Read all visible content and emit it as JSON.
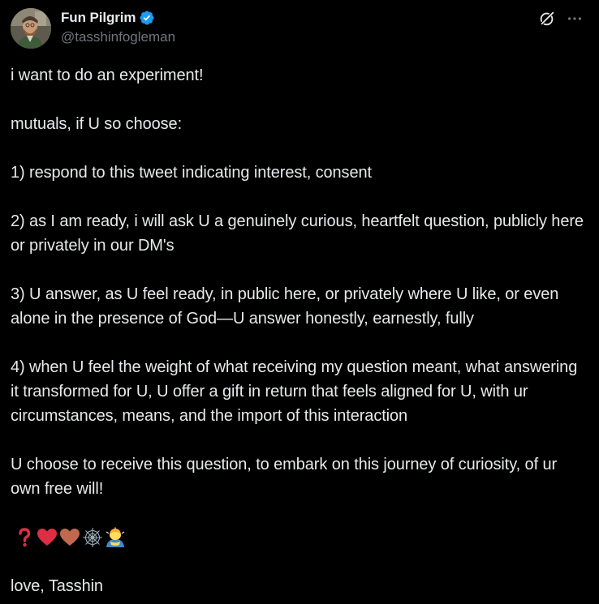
{
  "author": {
    "display_name": "Fun Pilgrim",
    "handle": "@tasshinfogleman",
    "verified": true,
    "verified_color": "#1d9bf0"
  },
  "header_actions": {
    "grok_icon": "grok-icon",
    "more_icon": "more-options-icon"
  },
  "tweet": {
    "paragraphs": [
      "i want to do an experiment!",
      "mutuals, if U so choose:",
      "1) respond to this tweet indicating interest, consent",
      "2) as I am ready, i will ask U a genuinely curious, heartfelt question, publicly here or privately in our DM's",
      "3) U answer, as U feel ready, in public here, or privately where U like, or even alone in the presence of God—U answer honestly, earnestly, fully",
      "4) when U feel the weight of what receiving my question meant, what answering it transformed for U, U offer a gift in return that feels aligned for U, with ur circumstances, means, and the import of this interaction",
      "U choose to receive this question, to embark on this journey of curiosity, of ur own free will!"
    ],
    "emojis": [
      "question-mark-emoji",
      "red-heart-emoji",
      "brown-heart-emoji",
      "spider-web-emoji",
      "man-bowing-emoji"
    ],
    "signoff": "love, Tasshin"
  },
  "colors": {
    "background": "#000000",
    "text": "#e7e9ea",
    "secondary_text": "#71767b",
    "verified": "#1d9bf0"
  }
}
